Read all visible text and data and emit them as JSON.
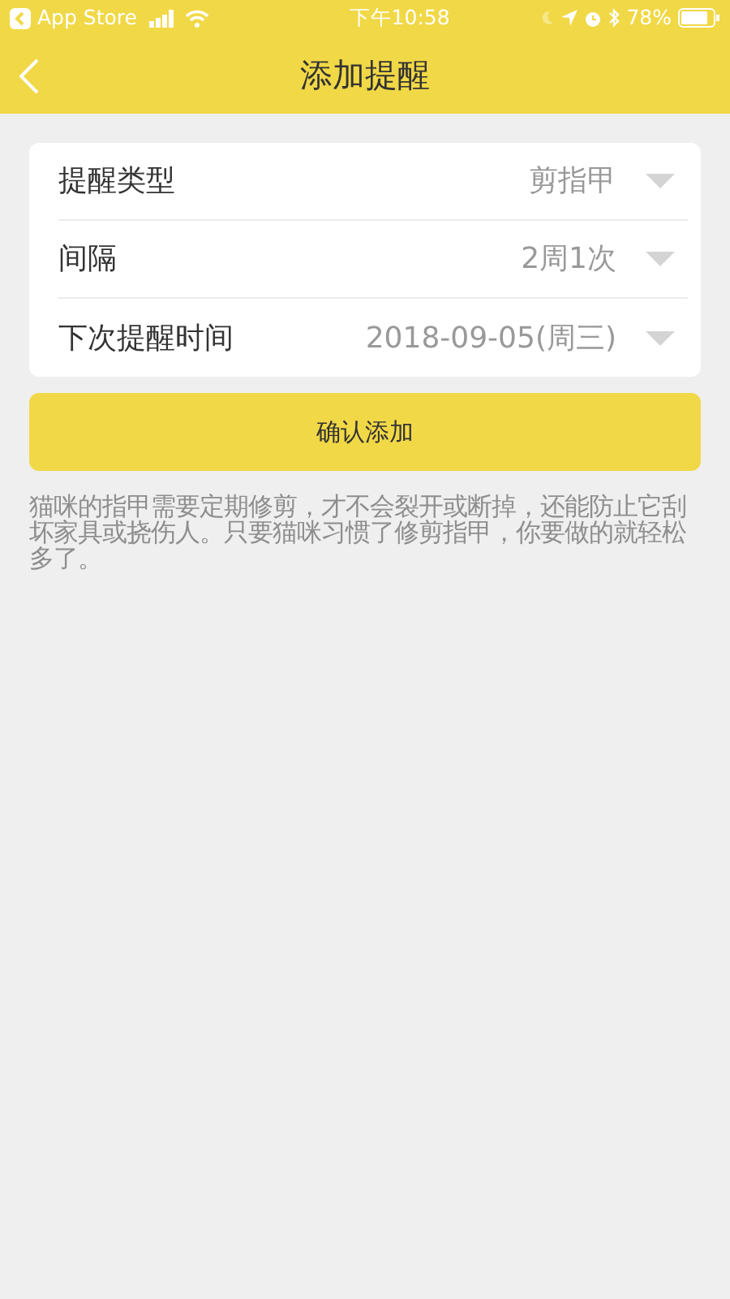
{
  "status_bar": {
    "back_app": "App Store",
    "time": "下午10:58",
    "battery": "78%"
  },
  "nav": {
    "title": "添加提醒"
  },
  "fields": [
    {
      "label": "提醒类型",
      "value": "剪指甲"
    },
    {
      "label": "间隔",
      "value": "2周1次"
    },
    {
      "label": "下次提醒时间",
      "value": "2018-09-05(周三)"
    }
  ],
  "confirm_button": "确认添加",
  "note": "猫咪的指甲需要定期修剪，才不会裂开或断掉，还能防止它刮坏家具或挠伤人。只要猫咪习惯了修剪指甲，你要做的就轻松多了。"
}
